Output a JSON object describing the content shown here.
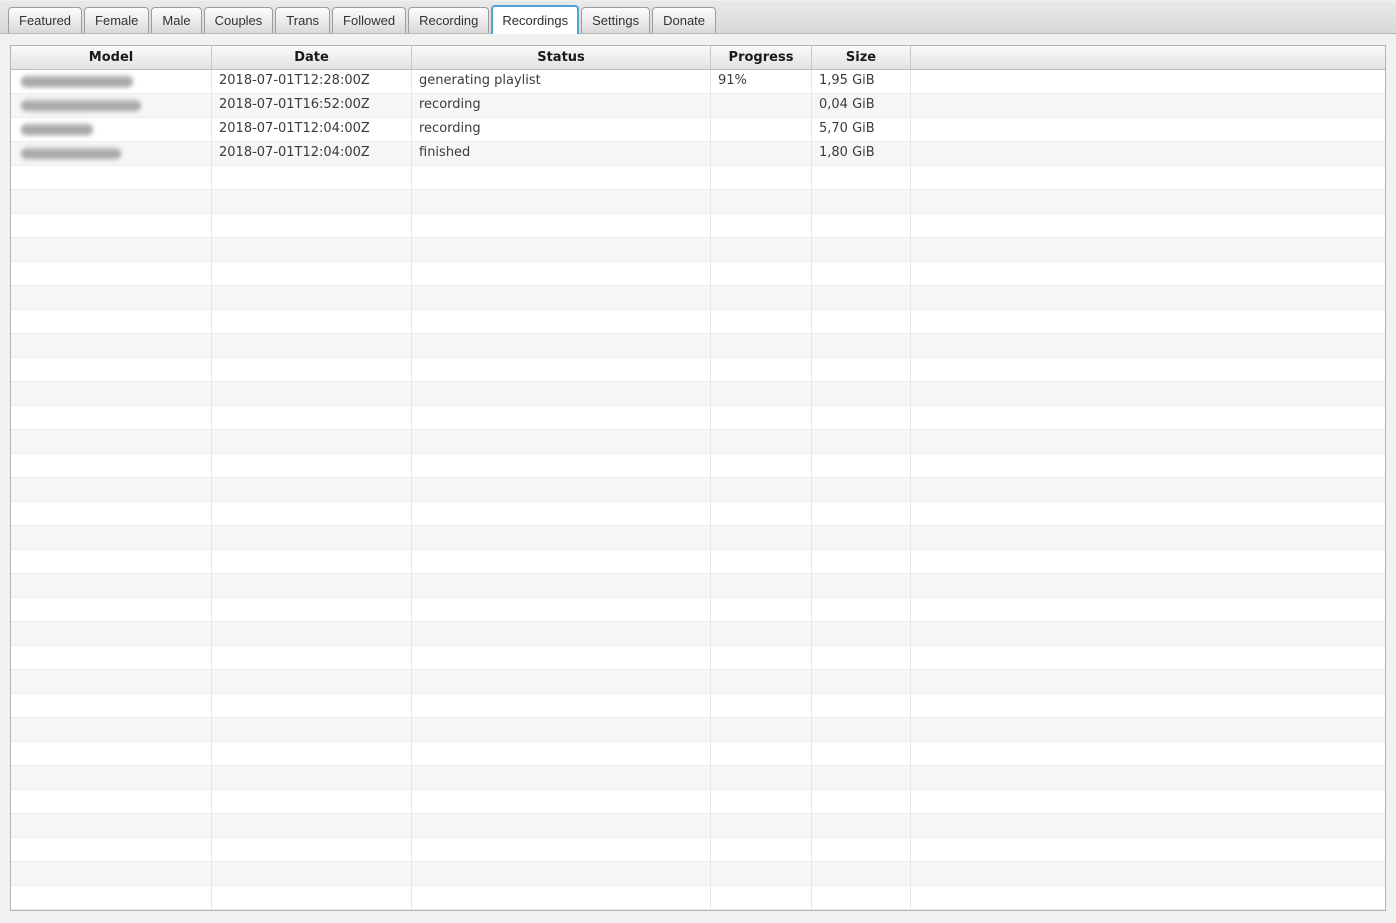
{
  "tabs": [
    {
      "label": "Featured",
      "selected": false
    },
    {
      "label": "Female",
      "selected": false
    },
    {
      "label": "Male",
      "selected": false
    },
    {
      "label": "Couples",
      "selected": false
    },
    {
      "label": "Trans",
      "selected": false
    },
    {
      "label": "Followed",
      "selected": false
    },
    {
      "label": "Recording",
      "selected": false
    },
    {
      "label": "Recordings",
      "selected": true
    },
    {
      "label": "Settings",
      "selected": false
    },
    {
      "label": "Donate",
      "selected": false
    }
  ],
  "table": {
    "columns": [
      {
        "label": "Model"
      },
      {
        "label": "Date"
      },
      {
        "label": "Status"
      },
      {
        "label": "Progress"
      },
      {
        "label": "Size"
      },
      {
        "label": ""
      }
    ],
    "rows": [
      {
        "model_redacted": true,
        "model_blur_width": 112,
        "date": "2018-07-01T12:28:00Z",
        "status": "generating playlist",
        "progress": "91%",
        "size": "1,95 GiB"
      },
      {
        "model_redacted": true,
        "model_blur_width": 120,
        "date": "2018-07-01T16:52:00Z",
        "status": "recording",
        "progress": "",
        "size": "0,04 GiB"
      },
      {
        "model_redacted": true,
        "model_blur_width": 72,
        "date": "2018-07-01T12:04:00Z",
        "status": "recording",
        "progress": "",
        "size": "5,70 GiB"
      },
      {
        "model_redacted": true,
        "model_blur_width": 100,
        "date": "2018-07-01T12:04:00Z",
        "status": "finished",
        "progress": "",
        "size": "1,80 GiB"
      }
    ],
    "empty_row_count": 31
  },
  "colors": {
    "selected_tab_border": "#50a5d5",
    "row_stripe": "#f6f6f6",
    "table_border": "#b3b3b3",
    "header_text": "#1a1a1a",
    "cell_text": "#3b3b3b"
  }
}
